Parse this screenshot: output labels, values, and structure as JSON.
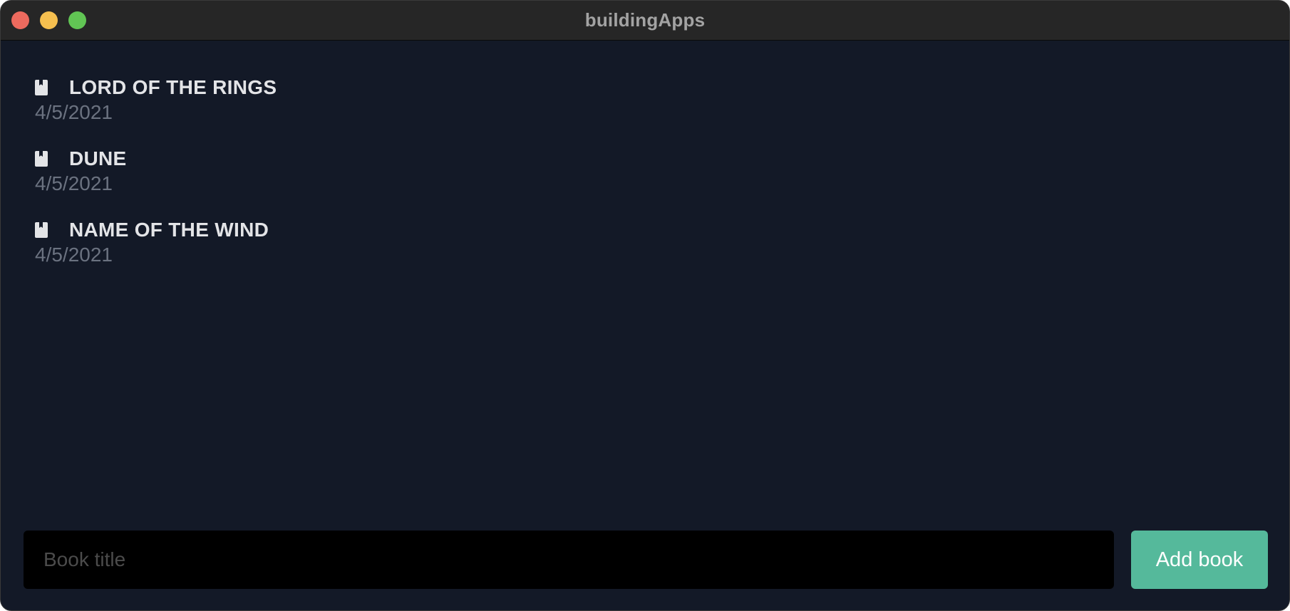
{
  "window": {
    "title": "buildingApps"
  },
  "books": [
    {
      "title": "LORD OF THE RINGS",
      "date": "4/5/2021",
      "icon": "book-icon"
    },
    {
      "title": "DUNE",
      "date": "4/5/2021",
      "icon": "book-icon"
    },
    {
      "title": "NAME OF THE WIND",
      "date": "4/5/2021",
      "icon": "book-icon"
    }
  ],
  "form": {
    "input_value": "",
    "input_placeholder": "Book title",
    "add_label": "Add book"
  },
  "colors": {
    "background": "#131927",
    "titlebar": "#262626",
    "accent": "#55b99b",
    "title_text": "#e3e4e7",
    "date_text": "#6b7280"
  }
}
